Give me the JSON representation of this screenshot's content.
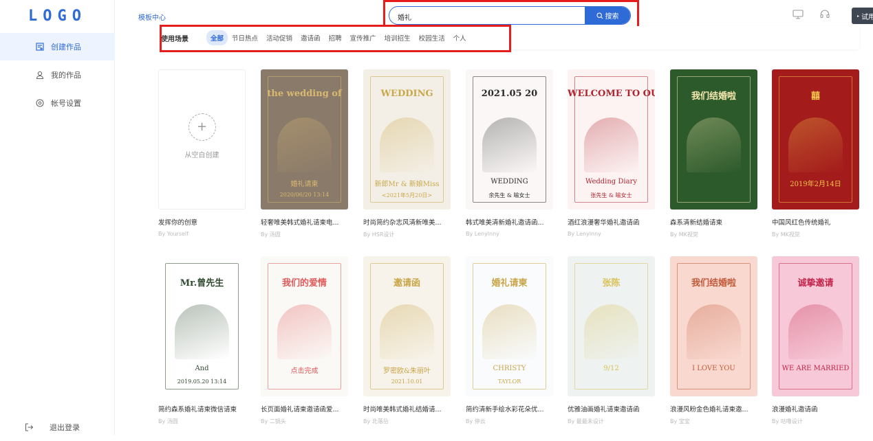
{
  "logo": "LOGO",
  "sidebar": {
    "items": [
      {
        "label": "创建作品",
        "icon": "create-icon",
        "active": true
      },
      {
        "label": "我的作品",
        "icon": "user-icon",
        "active": false
      },
      {
        "label": "帐号设置",
        "icon": "settings-icon",
        "active": false
      }
    ],
    "logout": {
      "label": "退出登录",
      "icon": "logout-icon"
    }
  },
  "topbar": {
    "breadcrumb": "模板中心",
    "search": {
      "value": "婚礼",
      "button_label": "搜索"
    },
    "try_button": "试用"
  },
  "filter": {
    "label": "使用场景",
    "options": [
      "全部",
      "节日热点",
      "活动促销",
      "邀请函",
      "招聘",
      "宣传推广",
      "培训招生",
      "校园生活",
      "个人"
    ],
    "selected": "全部"
  },
  "colors": {
    "accent": "#2f6bd7",
    "highlight_box": "#e51d1d"
  },
  "blank_card": {
    "text": "从空白创建",
    "title": "发挥你的创意",
    "author": "By Yourself"
  },
  "templates": [
    {
      "title": "轻奢唯美韩式婚礼请柬电...",
      "author": "By 汤圆",
      "thumb": {
        "bg": "#8a7a6a",
        "accent": "#d9b870",
        "text1": "the wedding of",
        "text2": "婚礼请柬",
        "text3": "2020/06/20 13:14"
      }
    },
    {
      "title": "时尚简约杂志风清新唯美...",
      "author": "By HSR设计",
      "thumb": {
        "bg": "#f4efe6",
        "accent": "#c9a84a",
        "text1": "WEDDING",
        "text2": "新郎Mr & 新娘Miss",
        "text3": "<2021年5月20日>"
      }
    },
    {
      "title": "韩式唯美清新婚礼邀请函...",
      "author": "By Lenylnny",
      "thumb": {
        "bg": "#fbf7f7",
        "accent": "#2a2a2a",
        "text1": "2021.05 20",
        "text2": "WEDDING",
        "text3": "余先生 & 喻女士"
      }
    },
    {
      "title": "酒红浪漫奢华婚礼邀请函",
      "author": "By Lenylnny",
      "thumb": {
        "bg": "#fdf3f3",
        "accent": "#b0242e",
        "text1": "WELCOME TO OUR WEDDING",
        "text2": "Wedding Diary",
        "text3": "张先生 & 喻女士"
      }
    },
    {
      "title": "森系清新结婚请柬",
      "author": "By MK视觉",
      "thumb": {
        "bg": "#2d5a2b",
        "accent": "#f5e8b0",
        "text1": "我们结婚啦",
        "text2": "",
        "text3": ""
      }
    },
    {
      "title": "中国风红色传统婚礼",
      "author": "By MK视觉",
      "thumb": {
        "bg": "#a31b1b",
        "accent": "#f2c44d",
        "text1": "囍",
        "text2": "2019年2月14日",
        "text3": ""
      }
    },
    {
      "title": "简约森系婚礼请柬微信请柬",
      "author": "By 汤圆",
      "thumb": {
        "bg": "#ffffff",
        "accent": "#2f4a2f",
        "text1": "Mr.曾先生",
        "text2": "And",
        "text3": "2019.05.20 13:14"
      }
    },
    {
      "title": "长页面婚礼请柬邀请函爱...",
      "author": "By 二锅头",
      "thumb": {
        "bg": "#fbf9f6",
        "accent": "#e05a5a",
        "text1": "我们的爱情",
        "text2": "点击完成",
        "text3": ""
      }
    },
    {
      "title": "时尚唯美韩式婚礼结婚请...",
      "author": "By 北落岳",
      "thumb": {
        "bg": "#f7f3ea",
        "accent": "#c9a548",
        "text1": "邀请函",
        "text2": "罗密欧&朱丽叶",
        "text3": "2021.10.01"
      }
    },
    {
      "title": "简约清新手绘水彩花朵优...",
      "author": "By 停云",
      "thumb": {
        "bg": "#f9fbfd",
        "accent": "#c9a548",
        "text1": "婚礼请柬",
        "text2": "CHRISTY",
        "text3": "TAYLOR"
      }
    },
    {
      "title": "优雅油画婚礼请柬邀请函",
      "author": "By 最最未设计",
      "thumb": {
        "bg": "#eef2f0",
        "accent": "#d9c25a",
        "text1": "张陈",
        "text2": "9/12",
        "text3": ""
      }
    },
    {
      "title": "浪漫风粉金色婚礼请柬邀...",
      "author": "By 宝宝",
      "thumb": {
        "bg": "#f9d8cf",
        "accent": "#c25a3a",
        "text1": "我们结婚啦",
        "text2": "I LOVE YOU",
        "text3": ""
      }
    },
    {
      "title": "浪漫婚礼邀请函",
      "author": "By 咕噜设计",
      "thumb": {
        "bg": "#f7c9d8",
        "accent": "#c2244a",
        "text1": "诚挚邀请",
        "text2": "WE ARE MARRIED",
        "text3": ""
      }
    }
  ]
}
